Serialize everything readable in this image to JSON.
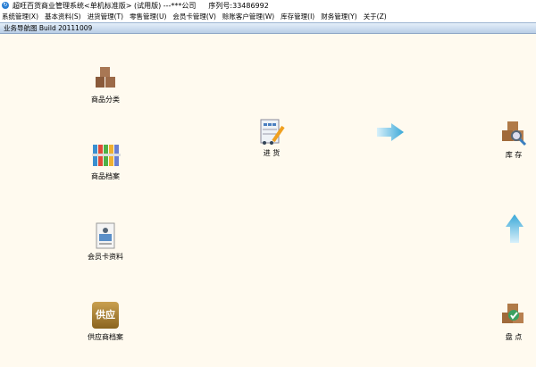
{
  "window": {
    "title": "超旺百货商业管理系统<单机标准版> (试用版) ---***公司",
    "serial": "序列号:33486992"
  },
  "menu": [
    "系统管理(X)",
    "基本资料(S)",
    "进货管理(T)",
    "零售管理(U)",
    "会员卡管理(V)",
    "赊账客户管理(W)",
    "库存管理(I)",
    "财务管理(Y)",
    "关于(Z)"
  ],
  "nav": {
    "header": "业务导航图 Build 20111009",
    "nodes": {
      "category": "商品分类",
      "archive": "商品档案",
      "member": "会员卡资料",
      "supplier": "供应商档案",
      "purchase": "进 货",
      "stock": "库 存",
      "inventory": "盘 点"
    },
    "supplier_icon_text": "供应"
  }
}
